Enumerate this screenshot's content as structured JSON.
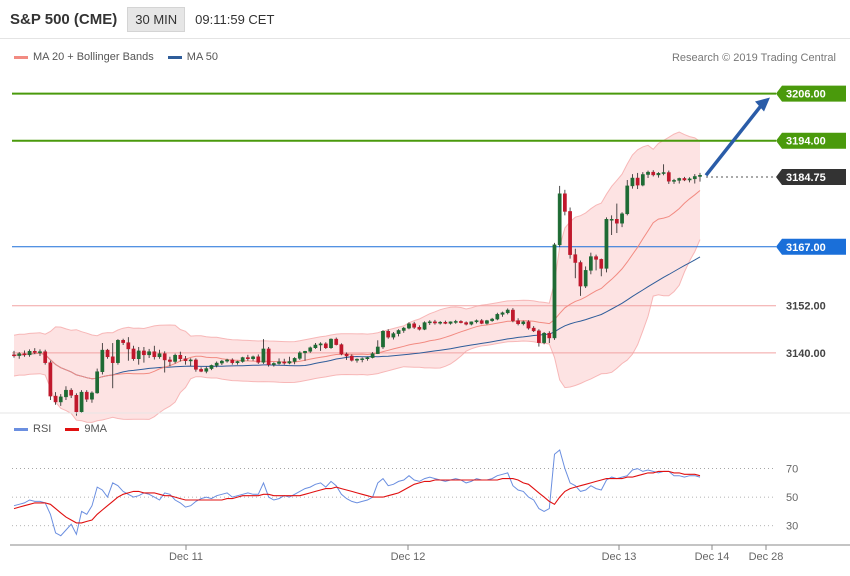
{
  "header": {
    "title": "S&P 500 (CME)",
    "interval": "30 MIN",
    "time": "09:11:59 CET"
  },
  "legend": {
    "ma20": "MA 20 + Bollinger Bands",
    "ma50": "MA 50",
    "rsi": "RSI",
    "ma9": "9MA",
    "credit": "Research © 2019 Trading Central"
  },
  "colors": {
    "ma20": "#f28b82",
    "ma50": "#2f5d9a",
    "band_fill": "#fde3e3",
    "bull": "#1e6b34",
    "bear": "#c0182c",
    "green_level": "#4a9a0c",
    "red_level": "#f2a3a3",
    "blue_level": "#1a6fd9",
    "current_price": "#333333",
    "rsi": "#6b8fe0",
    "rsi_ma": "#e01010"
  },
  "chart_data": [
    {
      "type": "candlestick",
      "title": "S&P 500 (CME)",
      "ylim": [
        3128,
        3212
      ],
      "x_labels": [
        "Dec 11",
        "Dec 12",
        "Dec 13",
        "Dec 14",
        "Dec 28"
      ],
      "price_labels": [
        "3206.00",
        "3194.00",
        "3184.75",
        "3167.00",
        "3152.00",
        "3140.00"
      ],
      "levels": [
        {
          "label": "3206.00",
          "value": 3206.0,
          "kind": "resistance"
        },
        {
          "label": "3194.00",
          "value": 3194.0,
          "kind": "resistance"
        },
        {
          "label": "3184.75",
          "value": 3184.75,
          "kind": "current"
        },
        {
          "label": "3167.00",
          "value": 3167.0,
          "kind": "pivot"
        },
        {
          "label": "3152.00",
          "value": 3152.0,
          "kind": "support"
        },
        {
          "label": "3140.00",
          "value": 3140.0,
          "kind": "support"
        }
      ],
      "target": {
        "from": 3185.2,
        "to": 3205.0
      },
      "candles": [
        [
          3139.5,
          3140.5,
          3138.8,
          3139.3
        ],
        [
          3139.3,
          3140.2,
          3138.5,
          3139.8
        ],
        [
          3139.8,
          3140.6,
          3139.0,
          3139.5
        ],
        [
          3139.5,
          3140.9,
          3139.0,
          3140.4
        ],
        [
          3140.4,
          3141.2,
          3139.7,
          3140.1
        ],
        [
          3140.1,
          3140.9,
          3139.2,
          3140.3
        ],
        [
          3140.3,
          3140.8,
          3137.0,
          3137.5
        ],
        [
          3137.5,
          3138.0,
          3128.0,
          3129.0
        ],
        [
          3129.0,
          3130.0,
          3126.8,
          3127.5
        ],
        [
          3127.5,
          3129.5,
          3126.5,
          3128.8
        ],
        [
          3128.8,
          3131.5,
          3128.0,
          3130.5
        ],
        [
          3130.5,
          3131.0,
          3128.5,
          3129.2
        ],
        [
          3129.2,
          3129.7,
          3124.0,
          3125.0
        ],
        [
          3125.0,
          3130.5,
          3124.8,
          3130.0
        ],
        [
          3130.0,
          3130.5,
          3127.5,
          3128.2
        ],
        [
          3128.2,
          3130.2,
          3127.3,
          3129.8
        ],
        [
          3129.8,
          3136.0,
          3129.6,
          3135.2
        ],
        [
          3135.2,
          3142.5,
          3134.5,
          3140.7
        ],
        [
          3140.7,
          3141.0,
          3138.5,
          3139.0
        ],
        [
          3139.0,
          3142.5,
          3131.0,
          3137.5
        ],
        [
          3137.5,
          3143.5,
          3137.0,
          3143.2
        ],
        [
          3143.2,
          3143.6,
          3142.0,
          3142.6
        ],
        [
          3142.6,
          3144.0,
          3138.0,
          3141.0
        ],
        [
          3141.0,
          3141.8,
          3138.0,
          3138.5
        ],
        [
          3138.5,
          3141.5,
          3137.0,
          3140.5
        ],
        [
          3140.5,
          3141.5,
          3137.5,
          3139.5
        ],
        [
          3139.5,
          3141.0,
          3138.7,
          3140.3
        ],
        [
          3140.3,
          3141.8,
          3138.3,
          3139.0
        ],
        [
          3139.0,
          3140.8,
          3138.5,
          3139.8
        ],
        [
          3139.8,
          3140.4,
          3135.0,
          3138.2
        ],
        [
          3138.2,
          3139.0,
          3136.6,
          3137.8
        ],
        [
          3137.8,
          3139.8,
          3137.3,
          3139.4
        ],
        [
          3139.4,
          3140.3,
          3137.8,
          3138.5
        ],
        [
          3138.5,
          3139.2,
          3137.0,
          3138.0
        ],
        [
          3138.0,
          3138.6,
          3136.7,
          3138.2
        ],
        [
          3138.2,
          3138.6,
          3135.2,
          3135.8
        ],
        [
          3135.8,
          3136.3,
          3135.1,
          3135.3
        ],
        [
          3135.3,
          3136.5,
          3134.8,
          3136.0
        ],
        [
          3136.0,
          3137.0,
          3135.6,
          3136.8
        ],
        [
          3136.8,
          3137.8,
          3136.3,
          3137.4
        ],
        [
          3137.4,
          3138.2,
          3136.9,
          3137.9
        ],
        [
          3137.9,
          3138.5,
          3137.5,
          3138.2
        ],
        [
          3138.2,
          3138.6,
          3137.0,
          3137.5
        ],
        [
          3137.5,
          3138.0,
          3137.0,
          3137.8
        ],
        [
          3137.8,
          3139.0,
          3137.5,
          3138.8
        ],
        [
          3138.8,
          3139.5,
          3138.0,
          3138.5
        ],
        [
          3138.5,
          3139.3,
          3138.0,
          3139.0
        ],
        [
          3139.0,
          3139.6,
          3137.2,
          3137.6
        ],
        [
          3137.6,
          3143.5,
          3137.2,
          3141.0
        ],
        [
          3141.0,
          3141.5,
          3136.5,
          3137.0
        ],
        [
          3137.0,
          3137.6,
          3136.5,
          3137.3
        ],
        [
          3137.3,
          3138.6,
          3137.0,
          3137.7
        ],
        [
          3137.7,
          3138.5,
          3137.0,
          3137.4
        ],
        [
          3137.4,
          3139.0,
          3137.1,
          3137.8
        ],
        [
          3137.8,
          3138.9,
          3137.1,
          3138.6
        ],
        [
          3138.6,
          3140.4,
          3138.2,
          3140.0
        ],
        [
          3140.0,
          3140.5,
          3138.0,
          3140.4
        ],
        [
          3140.4,
          3141.6,
          3140.0,
          3141.3
        ],
        [
          3141.3,
          3142.5,
          3141.0,
          3142.0
        ],
        [
          3142.0,
          3142.7,
          3140.5,
          3142.3
        ],
        [
          3142.3,
          3142.7,
          3141.0,
          3141.3
        ],
        [
          3141.3,
          3143.7,
          3141.0,
          3143.5
        ],
        [
          3143.5,
          3143.9,
          3141.9,
          3142.1
        ],
        [
          3142.1,
          3142.4,
          3139.4,
          3139.7
        ],
        [
          3139.7,
          3140.1,
          3138.2,
          3139.2
        ],
        [
          3139.2,
          3139.6,
          3137.8,
          3138.1
        ],
        [
          3138.1,
          3138.6,
          3137.5,
          3138.4
        ],
        [
          3138.4,
          3138.8,
          3137.6,
          3138.5
        ],
        [
          3138.5,
          3139.0,
          3138.0,
          3138.8
        ],
        [
          3138.8,
          3140.2,
          3138.6,
          3139.8
        ],
        [
          3139.8,
          3143.2,
          3139.7,
          3141.5
        ],
        [
          3141.5,
          3145.8,
          3141.0,
          3145.5
        ],
        [
          3145.5,
          3146.0,
          3143.6,
          3144.0
        ],
        [
          3144.0,
          3145.3,
          3143.4,
          3144.9
        ],
        [
          3144.9,
          3146.0,
          3144.2,
          3145.7
        ],
        [
          3145.7,
          3146.6,
          3145.1,
          3146.3
        ],
        [
          3146.3,
          3147.8,
          3146.0,
          3147.4
        ],
        [
          3147.4,
          3147.9,
          3146.1,
          3146.5
        ],
        [
          3146.5,
          3147.0,
          3145.7,
          3146.0
        ],
        [
          3146.0,
          3148.0,
          3145.8,
          3147.7
        ],
        [
          3147.7,
          3148.3,
          3147.1,
          3147.9
        ],
        [
          3147.9,
          3148.4,
          3147.2,
          3147.6
        ],
        [
          3147.6,
          3148.1,
          3147.2,
          3147.8
        ],
        [
          3147.8,
          3148.2,
          3147.3,
          3147.5
        ],
        [
          3147.5,
          3148.0,
          3147.2,
          3147.9
        ],
        [
          3147.9,
          3148.4,
          3147.4,
          3148.0
        ],
        [
          3148.0,
          3148.3,
          3147.5,
          3147.7
        ],
        [
          3147.7,
          3148.0,
          3147.0,
          3147.3
        ],
        [
          3147.3,
          3148.0,
          3147.0,
          3147.9
        ],
        [
          3147.9,
          3148.5,
          3147.5,
          3148.2
        ],
        [
          3148.2,
          3148.6,
          3147.3,
          3147.5
        ],
        [
          3147.5,
          3148.4,
          3147.2,
          3148.2
        ],
        [
          3148.2,
          3148.9,
          3147.9,
          3148.6
        ],
        [
          3148.6,
          3150.2,
          3148.3,
          3149.8
        ],
        [
          3149.8,
          3150.5,
          3149.2,
          3150.2
        ],
        [
          3150.2,
          3151.3,
          3149.8,
          3150.9
        ],
        [
          3150.9,
          3151.4,
          3147.8,
          3148.2
        ],
        [
          3148.2,
          3148.8,
          3147.0,
          3147.4
        ],
        [
          3147.4,
          3148.2,
          3147.0,
          3147.9
        ],
        [
          3147.9,
          3148.3,
          3145.9,
          3146.3
        ],
        [
          3146.3,
          3146.8,
          3145.3,
          3145.6
        ],
        [
          3145.6,
          3146.0,
          3141.6,
          3142.6
        ],
        [
          3142.6,
          3145.3,
          3142.2,
          3145.0
        ],
        [
          3145.0,
          3145.5,
          3142.5,
          3143.8
        ],
        [
          3143.8,
          3168.0,
          3143.3,
          3167.5
        ],
        [
          3167.5,
          3182.5,
          3167.0,
          3180.5
        ],
        [
          3180.5,
          3181.5,
          3175.0,
          3176.0
        ],
        [
          3176.0,
          3177.0,
          3164.0,
          3165.0
        ],
        [
          3165.0,
          3166.5,
          3159.0,
          3163.0
        ],
        [
          3163.0,
          3163.5,
          3154.5,
          3157.0
        ],
        [
          3157.0,
          3162.0,
          3156.5,
          3161.0
        ],
        [
          3161.0,
          3165.5,
          3160.0,
          3164.5
        ],
        [
          3164.5,
          3165.0,
          3161.0,
          3163.8
        ],
        [
          3163.8,
          3164.0,
          3159.5,
          3161.5
        ],
        [
          3161.5,
          3174.5,
          3160.5,
          3174.0
        ],
        [
          3174.0,
          3175.0,
          3170.0,
          3174.0
        ],
        [
          3174.0,
          3178.0,
          3170.5,
          3173.0
        ],
        [
          3173.0,
          3175.8,
          3172.0,
          3175.4
        ],
        [
          3175.4,
          3184.0,
          3175.0,
          3182.5
        ],
        [
          3182.5,
          3185.5,
          3181.8,
          3184.5
        ],
        [
          3184.5,
          3185.8,
          3181.7,
          3182.7
        ],
        [
          3182.7,
          3186.0,
          3182.4,
          3185.4
        ],
        [
          3185.4,
          3186.4,
          3184.5,
          3186.0
        ],
        [
          3186.0,
          3186.5,
          3184.9,
          3185.3
        ],
        [
          3185.3,
          3186.0,
          3184.6,
          3185.7
        ],
        [
          3185.7,
          3188.0,
          3185.2,
          3185.9
        ],
        [
          3185.9,
          3186.4,
          3183.0,
          3183.7
        ],
        [
          3183.7,
          3184.3,
          3183.0,
          3183.9
        ],
        [
          3183.9,
          3184.6,
          3183.1,
          3184.4
        ],
        [
          3184.4,
          3184.8,
          3183.7,
          3184.0
        ],
        [
          3184.0,
          3184.7,
          3183.4,
          3184.3
        ],
        [
          3184.3,
          3185.5,
          3183.1,
          3184.9
        ],
        [
          3184.9,
          3185.8,
          3183.6,
          3185.2
        ]
      ]
    },
    {
      "type": "line",
      "title": "",
      "ylim": [
        20,
        90
      ],
      "y_ticks": [
        30,
        50,
        70
      ],
      "series": [
        {
          "name": "RSI",
          "values": [
            44,
            45,
            46,
            48,
            47,
            47,
            46,
            38,
            25,
            23,
            27,
            31,
            24,
            40,
            38,
            44,
            57,
            55,
            50,
            60,
            58,
            54,
            52,
            50,
            51,
            53,
            52,
            50,
            48,
            53,
            52,
            48,
            46,
            43,
            44,
            47,
            49,
            50,
            49,
            51,
            52,
            53,
            50,
            51,
            52,
            53,
            52,
            52,
            60,
            50,
            48,
            49,
            51,
            50,
            52,
            54,
            56,
            57,
            59,
            60,
            57,
            61,
            58,
            52,
            49,
            47,
            46,
            47,
            48,
            50,
            60,
            63,
            58,
            59,
            61,
            62,
            65,
            62,
            61,
            63,
            64,
            63,
            62,
            61,
            62,
            63,
            62,
            60,
            61,
            63,
            62,
            62,
            63,
            65,
            66,
            67,
            58,
            55,
            54,
            50,
            48,
            42,
            40,
            42,
            80,
            83,
            70,
            60,
            58,
            54,
            55,
            58,
            56,
            55,
            62,
            64,
            63,
            64,
            65,
            69,
            70,
            68,
            69,
            68,
            67,
            68,
            68,
            65,
            65,
            64,
            65,
            65,
            64
          ]
        },
        {
          "name": "9MA",
          "values": [
            42,
            43,
            44,
            45,
            46,
            46,
            46,
            45,
            42,
            39,
            36,
            34,
            32,
            32,
            33,
            34,
            38,
            41,
            44,
            47,
            50,
            52,
            53,
            54,
            54,
            53,
            53,
            53,
            52,
            51,
            51,
            50,
            49,
            48,
            48,
            48,
            48,
            48,
            48,
            48,
            48,
            49,
            49,
            50,
            51,
            51,
            51,
            51,
            52,
            52,
            51,
            51,
            51,
            51,
            51,
            51,
            52,
            53,
            54,
            55,
            56,
            56,
            57,
            56,
            55,
            54,
            53,
            52,
            51,
            50,
            50,
            50,
            51,
            52,
            53,
            55,
            57,
            59,
            60,
            61,
            61,
            62,
            62,
            62,
            62,
            62,
            62,
            62,
            62,
            62,
            62,
            62,
            62,
            62,
            63,
            63,
            63,
            62,
            60,
            59,
            56,
            53,
            50,
            47,
            45,
            50,
            54,
            56,
            57,
            58,
            59,
            60,
            61,
            62,
            63,
            63,
            63,
            63,
            64,
            64,
            65,
            66,
            67,
            67,
            68,
            68,
            68,
            67,
            67,
            66,
            66,
            66,
            65
          ]
        }
      ]
    }
  ]
}
